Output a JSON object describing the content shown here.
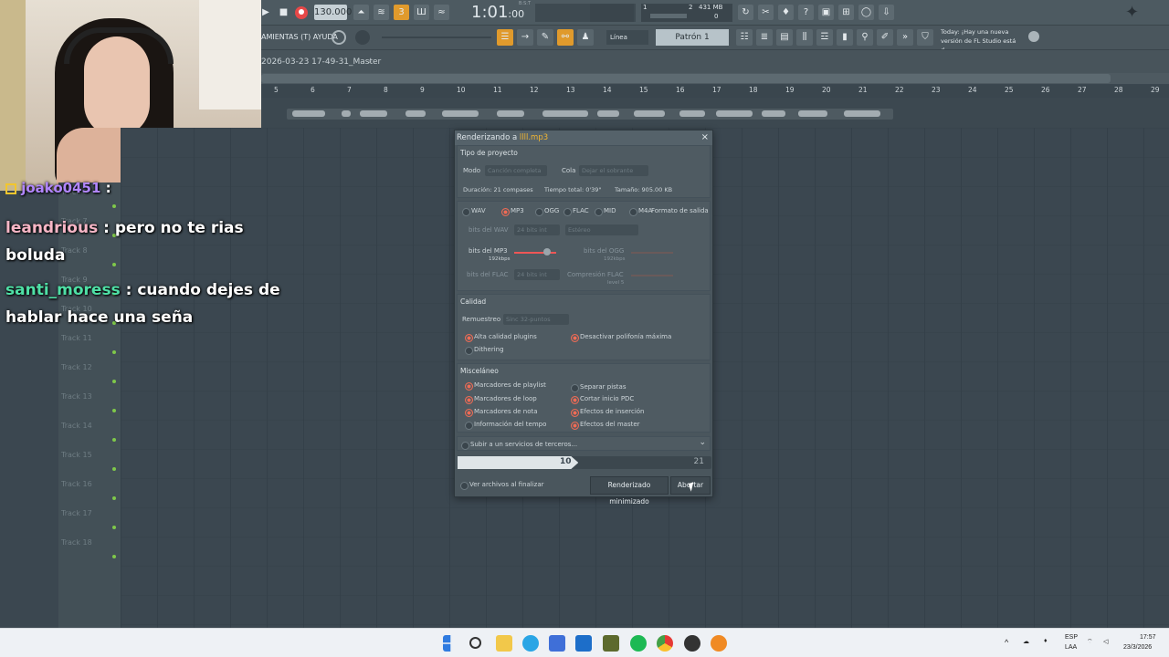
{
  "toolbar": {
    "tempo": "130.000",
    "time_display": "1:01",
    "time_sub": ":00",
    "time_label": "B:S:T",
    "memory": "431 MB",
    "cpu_a": "1",
    "cpu_b": "2",
    "cpu_c": "0",
    "menu_label": "AMIENTAS (T) AYUDA",
    "snap": "Línea",
    "pattern": "Patrón 1",
    "news": "Today: ¡Hay una nueva versión de FL Studio está d..."
  },
  "playlist": {
    "path": "2026-03-23 17-49-31_Master",
    "ruler": [
      "5",
      "6",
      "7",
      "8",
      "9",
      "10",
      "11",
      "12",
      "13",
      "14",
      "15",
      "16",
      "17",
      "18",
      "19",
      "20",
      "21",
      "22",
      "23",
      "24",
      "25",
      "26",
      "27",
      "28",
      "29"
    ],
    "tracks": [
      "Track 6",
      "Track 7",
      "Track 8",
      "Track 9",
      "Track 10",
      "Track 11",
      "Track 12",
      "Track 13",
      "Track 14",
      "Track 15",
      "Track 16",
      "Track 17",
      "Track 18"
    ]
  },
  "chat": {
    "line0_user": "joako0451",
    "line1_user": "leandrious",
    "line1_msg": ": pero no te rias",
    "line1_cont": "boluda",
    "line2_user": "santi_moress",
    "line2_msg": ": cuando dejes de",
    "line2_cont": "hablar hace una seña",
    "colors": {
      "joako": "#b186ff",
      "leandrious": "#f7b6c6",
      "santi": "#4fe0a6"
    }
  },
  "dialog": {
    "title_prefix": "Renderizando a ",
    "filename": "llll.mp3",
    "close": "×",
    "project": {
      "header": "Tipo de proyecto",
      "mode_label": "Modo",
      "mode_value": "Canción completa",
      "tail_label": "Cola",
      "tail_value": "Dejar el sobrante",
      "duration": "Duración: 21 compases",
      "total_time": "Tiempo total: 0'39\"",
      "size": "Tamaño: 905.00 KB"
    },
    "formats": {
      "options": [
        "WAV",
        "MP3",
        "OGG",
        "FLAC",
        "MID",
        "M4A"
      ],
      "selected": "MP3",
      "label": "Formato de salida",
      "wav_bits_label": "bits del WAV",
      "wav_bits_value": "24 bits int",
      "channels_value": "Estéreo",
      "mp3_bits_label": "bits del MP3",
      "mp3_bits_value": "192kbps",
      "ogg_bits_label": "bits del OGG",
      "ogg_bits_value": "192kbps",
      "flac_bits_label": "bits del FLAC",
      "flac_bits_value": "24 bits int",
      "flac_comp_label": "Compresión FLAC",
      "flac_comp_value": "level 5"
    },
    "quality": {
      "header": "Calidad",
      "resample_label": "Remuestreo",
      "resample_value": "Sinc 32-puntos",
      "hq_plugins": "Alta calidad plugins",
      "disable_poly": "Desactivar polifonía máxima",
      "dithering": "Dithering"
    },
    "misc": {
      "header": "Misceláneo",
      "playlist_markers": "Marcadores de playlist",
      "loop_markers": "Marcadores de loop",
      "note_markers": "Marcadores de nota",
      "tempo_info": "Información del tempo",
      "split_tracks": "Separar pistas",
      "trim_pdc": "Cortar inicio PDC",
      "insert_effects": "Efectos de inserción",
      "master_effects": "Efectos del master"
    },
    "upload": "Subir a un servicios de terceros...",
    "progress_current": "10",
    "progress_total": "21",
    "progress_fraction": 0.476,
    "view_files": "Ver archivos al finalizar",
    "minimized_button": "Renderizado minimizado",
    "abort_button": "Abortar"
  },
  "taskbar": {
    "lang": "ESP",
    "lang_sub": "LAA",
    "time": "17:57",
    "date": "23/3/2026"
  }
}
